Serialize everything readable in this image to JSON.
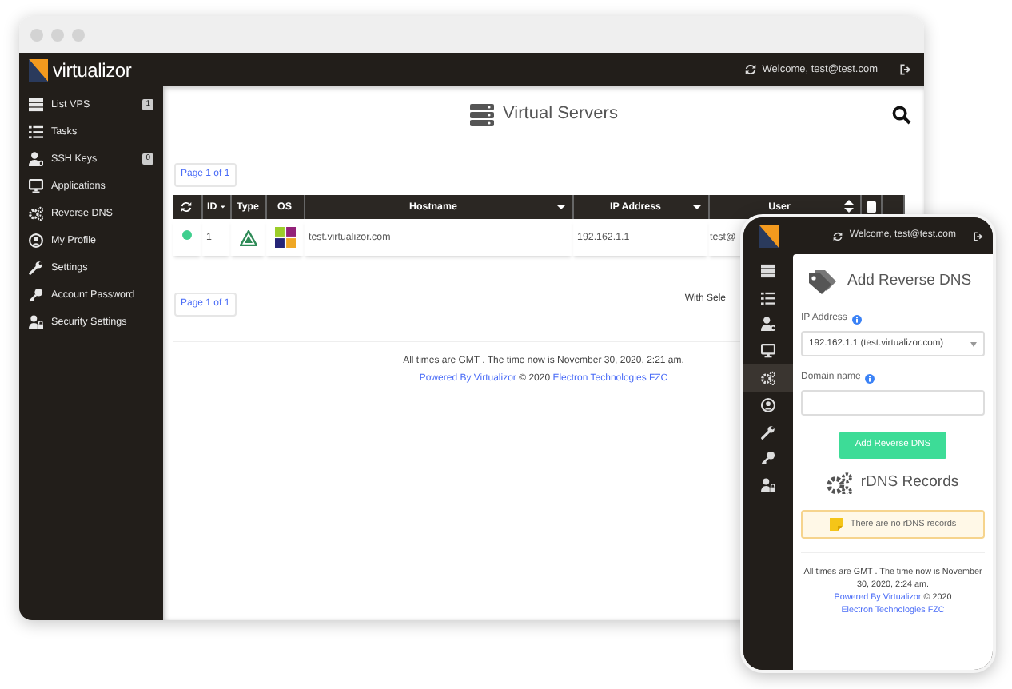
{
  "browser": {
    "logo": "virtualizor",
    "header": {
      "welcome": "Welcome, test@test.com"
    },
    "sidebar": {
      "items": [
        {
          "label": "List VPS",
          "badge": "1"
        },
        {
          "label": "Tasks"
        },
        {
          "label": "SSH Keys",
          "badge": "0"
        },
        {
          "label": "Applications"
        },
        {
          "label": "Reverse DNS"
        },
        {
          "label": "My Profile"
        },
        {
          "label": "Settings"
        },
        {
          "label": "Account Password"
        },
        {
          "label": "Security Settings"
        }
      ]
    },
    "page": {
      "title": "Virtual Servers",
      "pagination_top": "Page 1 of 1",
      "table": {
        "columns": [
          {
            "kind": "refresh"
          },
          {
            "kind": "text",
            "label": "ID",
            "sortable": true,
            "sorted": true
          },
          {
            "kind": "text",
            "label": "Type"
          },
          {
            "kind": "text",
            "label": "OS"
          },
          {
            "kind": "text",
            "label": "Hostname",
            "sortable": true,
            "sorted": true
          },
          {
            "kind": "text",
            "label": "IP Address",
            "sortable": true,
            "sorted": true
          },
          {
            "kind": "text",
            "label": "User",
            "sortable": true,
            "sorted": false
          },
          {
            "kind": "checkbox",
            "checked": false
          },
          {
            "kind": "blank"
          }
        ],
        "rows": [
          {
            "color": "#3ecf8e",
            "id": "1",
            "hostname": "test.virtualizor.com",
            "ip": "192.162.1.1",
            "user": "test@"
          }
        ]
      },
      "pagination_bottom": "Page 1 of 1",
      "with_selected": "With Sele"
    },
    "footer": {
      "time": "All times are GMT . The time now is November 30, 2020, 2:21 am.",
      "powered": "Powered By Virtualizor",
      "copyright": "© 2020",
      "company": "Electron Technologies FZC"
    }
  },
  "phone": {
    "header": {
      "welcome": "Welcome, test@test.com"
    },
    "nav": [
      {
        "selected": false
      },
      {
        "selected": false
      },
      {
        "selected": false
      },
      {
        "selected": false
      },
      {
        "selected": true
      },
      {
        "selected": false
      },
      {
        "selected": false
      },
      {
        "selected": false
      },
      {
        "selected": false
      }
    ],
    "title": "Add Reverse DNS",
    "form": {
      "ip_label": "IP Address",
      "ip_value": "192.162.1.1 (test.virtualizor.com)",
      "domain_label": "Domain name",
      "submit": "Add Reverse DNS"
    },
    "records_title": "rDNS Records",
    "empty_message": "There are no rDNS records",
    "footer": {
      "time": "All times are GMT . The time now is November 30, 2020, 2:24 am.",
      "powered": "Powered By Virtualizor",
      "copyright": "© 2020",
      "company": "Electron Technologies FZC"
    }
  }
}
